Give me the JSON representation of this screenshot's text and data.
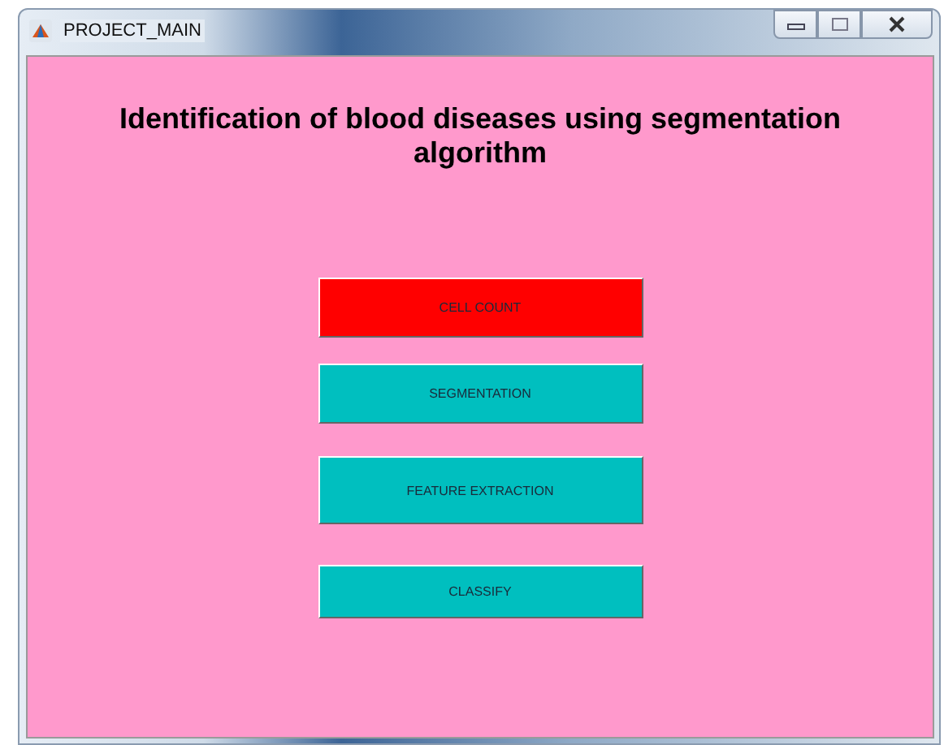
{
  "window": {
    "title": "PROJECT_MAIN"
  },
  "heading": "Identification of blood diseases using segmentation algorithm",
  "buttons": [
    {
      "label": "CELL COUNT",
      "color": "#ff0000"
    },
    {
      "label": "SEGMENTATION",
      "color": "#00bfbf"
    },
    {
      "label": "FEATURE EXTRACTION",
      "color": "#00bfbf"
    },
    {
      "label": "CLASSIFY",
      "color": "#00bfbf"
    }
  ]
}
